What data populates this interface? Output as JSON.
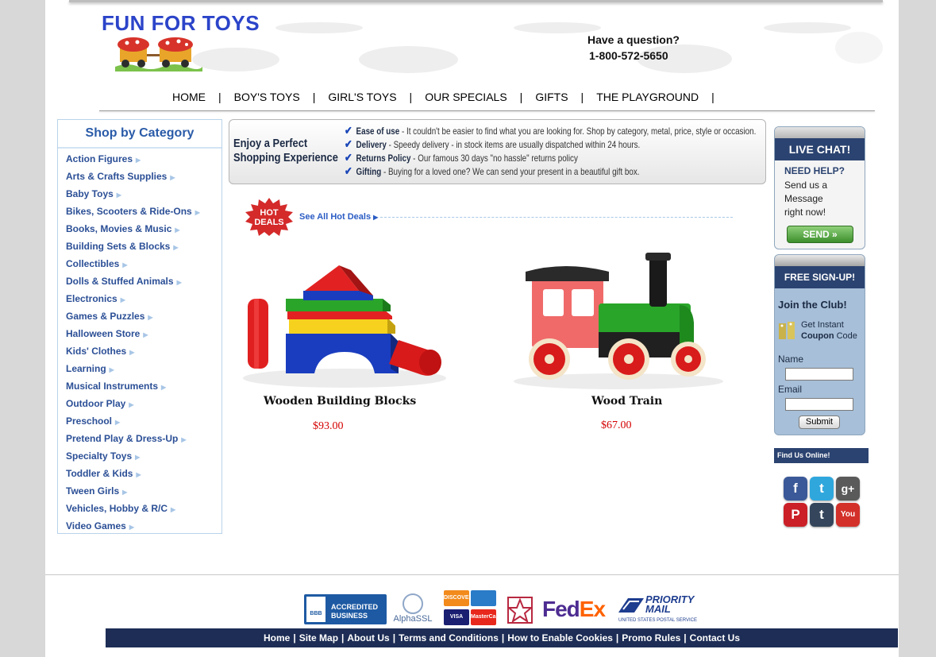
{
  "brand": {
    "name": "FUN FOR TOYS"
  },
  "contact": {
    "question": "Have a question?",
    "phone": "1-800-572-5650"
  },
  "nav": {
    "items": [
      "HOME",
      "BOY'S TOYS",
      "GIRL'S TOYS",
      "OUR SPECIALS",
      "GIFTS",
      "THE PLAYGROUND"
    ],
    "separator": "|"
  },
  "categories": {
    "title": "Shop by Category",
    "items": [
      "Action Figures",
      "Arts & Crafts Supplies",
      "Baby Toys",
      "Bikes, Scooters & Ride-Ons",
      "Books, Movies & Music",
      "Building Sets & Blocks",
      "Collectibles",
      "Dolls & Stuffed Animals",
      "Electronics",
      "Games & Puzzles",
      "Halloween Store",
      "Kids' Clothes",
      "Learning",
      "Musical Instruments",
      "Outdoor Play",
      "Preschool",
      "Pretend Play & Dress-Up",
      "Specialty Toys",
      "Toddler & Kids",
      "Tween Girls",
      "Vehicles, Hobby & R/C",
      "Video Games"
    ]
  },
  "banner": {
    "headline_1": "Enjoy a Perfect",
    "headline_2": "Shopping Experience",
    "benefits": [
      {
        "title": "Ease of use",
        "text": " - It couldn't be easier to find what you are looking for. Shop by category, metal, price, style or occasion."
      },
      {
        "title": "Delivery",
        "text": " - Speedy delivery - in stock items are usually dispatched within 24 hours."
      },
      {
        "title": "Returns Policy",
        "text": " - Our famous 30 days \"no hassle\" returns policy"
      },
      {
        "title": "Gifting",
        "text": " - Buying for a loved one? We can send your present in a beautiful gift box."
      }
    ]
  },
  "hot_deals": {
    "badge_1": "HOT",
    "badge_2": "DEALS",
    "link": "See All Hot Deals"
  },
  "products": [
    {
      "name": "Wooden Building Blocks",
      "price": "$93.00"
    },
    {
      "name": "Wood Train",
      "price": "$67.00"
    }
  ],
  "live_chat": {
    "title": "LIVE CHAT!",
    "need_help": "NEED HELP?",
    "line_1": "Send us a",
    "line_2": "Message",
    "line_3": "right now!",
    "send": "SEND"
  },
  "signup": {
    "title": "FREE SIGN-UP!",
    "join": "Join the Club!",
    "get_instant": "Get Instant",
    "coupon": "Coupon",
    "code": " Code",
    "name_label": "Name",
    "email_label": "Email",
    "submit": "Submit"
  },
  "social": {
    "title": "Find Us Online!",
    "icons": [
      "facebook-icon",
      "twitter-icon",
      "google-plus-icon",
      "pinterest-icon",
      "tumblr-icon",
      "youtube-icon"
    ],
    "glyphs": [
      "f",
      "t",
      "g+",
      "P",
      "t",
      "You"
    ]
  },
  "badges": {
    "bbb_1": "ACCREDITED",
    "bbb_2": "BUSINESS",
    "bbb_mark": "BBB",
    "alphassl": "AlphaSSL",
    "fedex_1": "Fed",
    "fedex_2": "Ex",
    "usps_1": "PRIORITY",
    "usps_2": "MAIL",
    "usps_small": "UNITED STATES POSTAL SERVICE",
    "discover": "DISCOVER",
    "visa": "VISA",
    "mastercard": "MasterCard"
  },
  "footer": {
    "links": [
      "Home",
      "Site Map",
      "About Us",
      "Terms and Conditions",
      "How to Enable Cookies",
      "Promo Rules",
      "Contact Us"
    ],
    "separator": "|"
  },
  "colors": {
    "brand_blue": "#2b44c9",
    "navy": "#2b4370",
    "price_red": "#d40000",
    "link_blue": "#2b4f96"
  }
}
